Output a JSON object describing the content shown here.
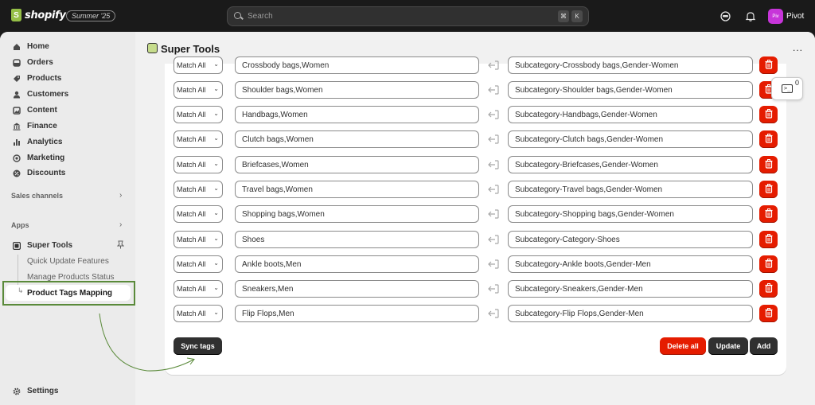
{
  "topbar": {
    "logo_text": "shopify",
    "edition_badge": "Summer '25",
    "search_placeholder": "Search",
    "shortcut_keys": [
      "⌘",
      "K"
    ],
    "store_avatar_initials": "Piv",
    "store_name": "Pivot"
  },
  "sidebar": {
    "items": [
      {
        "label": "Home",
        "icon": "home-icon"
      },
      {
        "label": "Orders",
        "icon": "orders-icon"
      },
      {
        "label": "Products",
        "icon": "tag-icon"
      },
      {
        "label": "Customers",
        "icon": "person-icon"
      },
      {
        "label": "Content",
        "icon": "content-icon"
      },
      {
        "label": "Finance",
        "icon": "bank-icon"
      },
      {
        "label": "Analytics",
        "icon": "bar-chart-icon"
      },
      {
        "label": "Marketing",
        "icon": "target-icon"
      },
      {
        "label": "Discounts",
        "icon": "discount-icon"
      }
    ],
    "sales_channels_label": "Sales channels",
    "apps_label": "Apps",
    "app": {
      "label": "Super Tools",
      "sub_items": [
        "Quick Update Features",
        "Manage Products Status",
        "Product Tags Mapping"
      ],
      "active_sub_item": "Product Tags Mapping"
    },
    "settings_label": "Settings"
  },
  "page": {
    "title": "Super Tools",
    "more_label": "..."
  },
  "mappings": [
    {
      "match": "Match All",
      "tags": "Crossbody bags,Women",
      "target": "Subcategory-Crossbody bags,Gender-Women"
    },
    {
      "match": "Match All",
      "tags": "Shoulder bags,Women",
      "target": "Subcategory-Shoulder bags,Gender-Women"
    },
    {
      "match": "Match All",
      "tags": "Handbags,Women",
      "target": "Subcategory-Handbags,Gender-Women"
    },
    {
      "match": "Match All",
      "tags": "Clutch bags,Women",
      "target": "Subcategory-Clutch bags,Gender-Women"
    },
    {
      "match": "Match All",
      "tags": "Briefcases,Women",
      "target": "Subcategory-Briefcases,Gender-Women"
    },
    {
      "match": "Match All",
      "tags": "Travel bags,Women",
      "target": "Subcategory-Travel bags,Gender-Women"
    },
    {
      "match": "Match All",
      "tags": "Shopping bags,Women",
      "target": "Subcategory-Shopping bags,Gender-Women"
    },
    {
      "match": "Match All",
      "tags": "Shoes",
      "target": "Subcategory-Category-Shoes"
    },
    {
      "match": "Match All",
      "tags": "Ankle boots,Men",
      "target": "Subcategory-Ankle boots,Gender-Men"
    },
    {
      "match": "Match All",
      "tags": "Sneakers,Men",
      "target": "Subcategory-Sneakers,Gender-Men"
    },
    {
      "match": "Match All",
      "tags": "Flip Flops,Men",
      "target": "Subcategory-Flip Flops,Gender-Men"
    }
  ],
  "actions": {
    "sync_label": "Sync tags",
    "delete_all_label": "Delete all",
    "update_label": "Update",
    "add_label": "Add"
  },
  "floating": {
    "count": "0"
  },
  "colors": {
    "danger": "#e51c00",
    "primary_dark": "#303030",
    "highlight_green": "#5a8a3a"
  }
}
